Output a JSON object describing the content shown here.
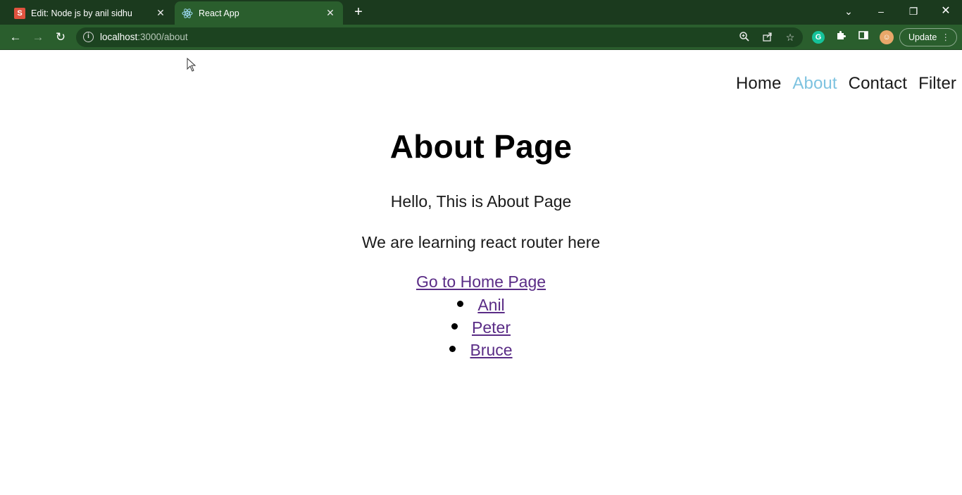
{
  "browser": {
    "tabs": [
      {
        "title": "Edit: Node js by anil sidhu",
        "favicon": "S",
        "active": false
      },
      {
        "title": "React App",
        "favicon": "react-icon",
        "active": true
      }
    ],
    "address": {
      "host": "localhost",
      "path": ":3000/about"
    },
    "update_label": "Update"
  },
  "nav": {
    "items": [
      {
        "label": "Home",
        "active": false
      },
      {
        "label": "About",
        "active": true
      },
      {
        "label": "Contact",
        "active": false
      },
      {
        "label": "Filter",
        "active": false
      }
    ],
    "active_color": "#7ec3e0"
  },
  "page": {
    "title": "About Page",
    "paragraph1": "Hello, This is About Page",
    "paragraph2": "We are learning react router here",
    "home_link": "Go to Home Page",
    "users": [
      "Anil",
      "Peter",
      "Bruce"
    ],
    "link_color": "#5a2c86"
  }
}
